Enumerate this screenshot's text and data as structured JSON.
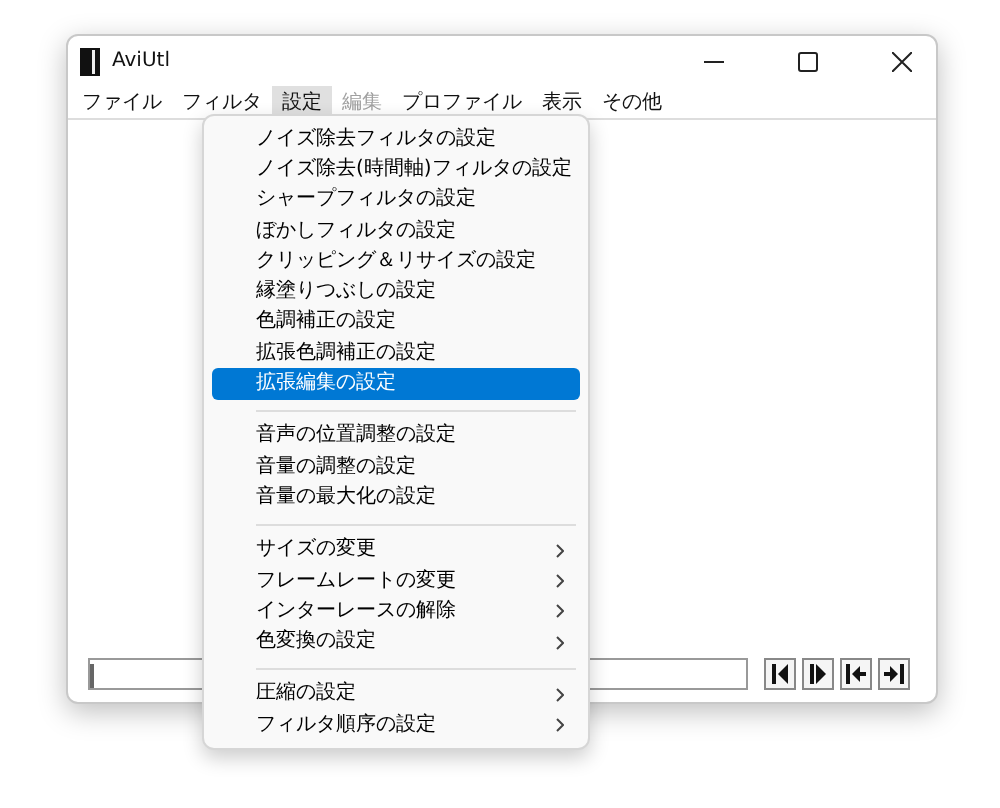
{
  "window": {
    "title": "AviUtl"
  },
  "menu_bar": [
    {
      "label": "ファイル",
      "selected": false,
      "disabled": false
    },
    {
      "label": "フィルタ",
      "selected": false,
      "disabled": false
    },
    {
      "label": "設定",
      "selected": true,
      "disabled": false
    },
    {
      "label": "編集",
      "selected": false,
      "disabled": true
    },
    {
      "label": "プロファイル",
      "selected": false,
      "disabled": false
    },
    {
      "label": "表示",
      "selected": false,
      "disabled": false
    },
    {
      "label": "その他",
      "selected": false,
      "disabled": false
    }
  ],
  "dropdown_menu": {
    "groups": [
      [
        {
          "label": "ノイズ除去フィルタの設定",
          "selected": false,
          "submenu": false
        },
        {
          "label": "ノイズ除去(時間軸)フィルタの設定",
          "selected": false,
          "submenu": false
        },
        {
          "label": "シャープフィルタの設定",
          "selected": false,
          "submenu": false
        },
        {
          "label": "ぼかしフィルタの設定",
          "selected": false,
          "submenu": false
        },
        {
          "label": "クリッピング＆リサイズの設定",
          "selected": false,
          "submenu": false
        },
        {
          "label": "縁塗りつぶしの設定",
          "selected": false,
          "submenu": false
        },
        {
          "label": "色調補正の設定",
          "selected": false,
          "submenu": false
        },
        {
          "label": "拡張色調補正の設定",
          "selected": false,
          "submenu": false
        },
        {
          "label": "拡張編集の設定",
          "selected": true,
          "submenu": false
        }
      ],
      [
        {
          "label": "音声の位置調整の設定",
          "selected": false,
          "submenu": false
        },
        {
          "label": "音量の調整の設定",
          "selected": false,
          "submenu": false
        },
        {
          "label": "音量の最大化の設定",
          "selected": false,
          "submenu": false
        }
      ],
      [
        {
          "label": "サイズの変更",
          "selected": false,
          "submenu": true
        },
        {
          "label": "フレームレートの変更",
          "selected": false,
          "submenu": true
        },
        {
          "label": "インターレースの解除",
          "selected": false,
          "submenu": true
        },
        {
          "label": "色変換の設定",
          "selected": false,
          "submenu": true
        }
      ],
      [
        {
          "label": "圧縮の設定",
          "selected": false,
          "submenu": true
        },
        {
          "label": "フィルタ順序の設定",
          "selected": false,
          "submenu": true
        }
      ]
    ]
  },
  "seek_bar": {
    "level": 0
  }
}
